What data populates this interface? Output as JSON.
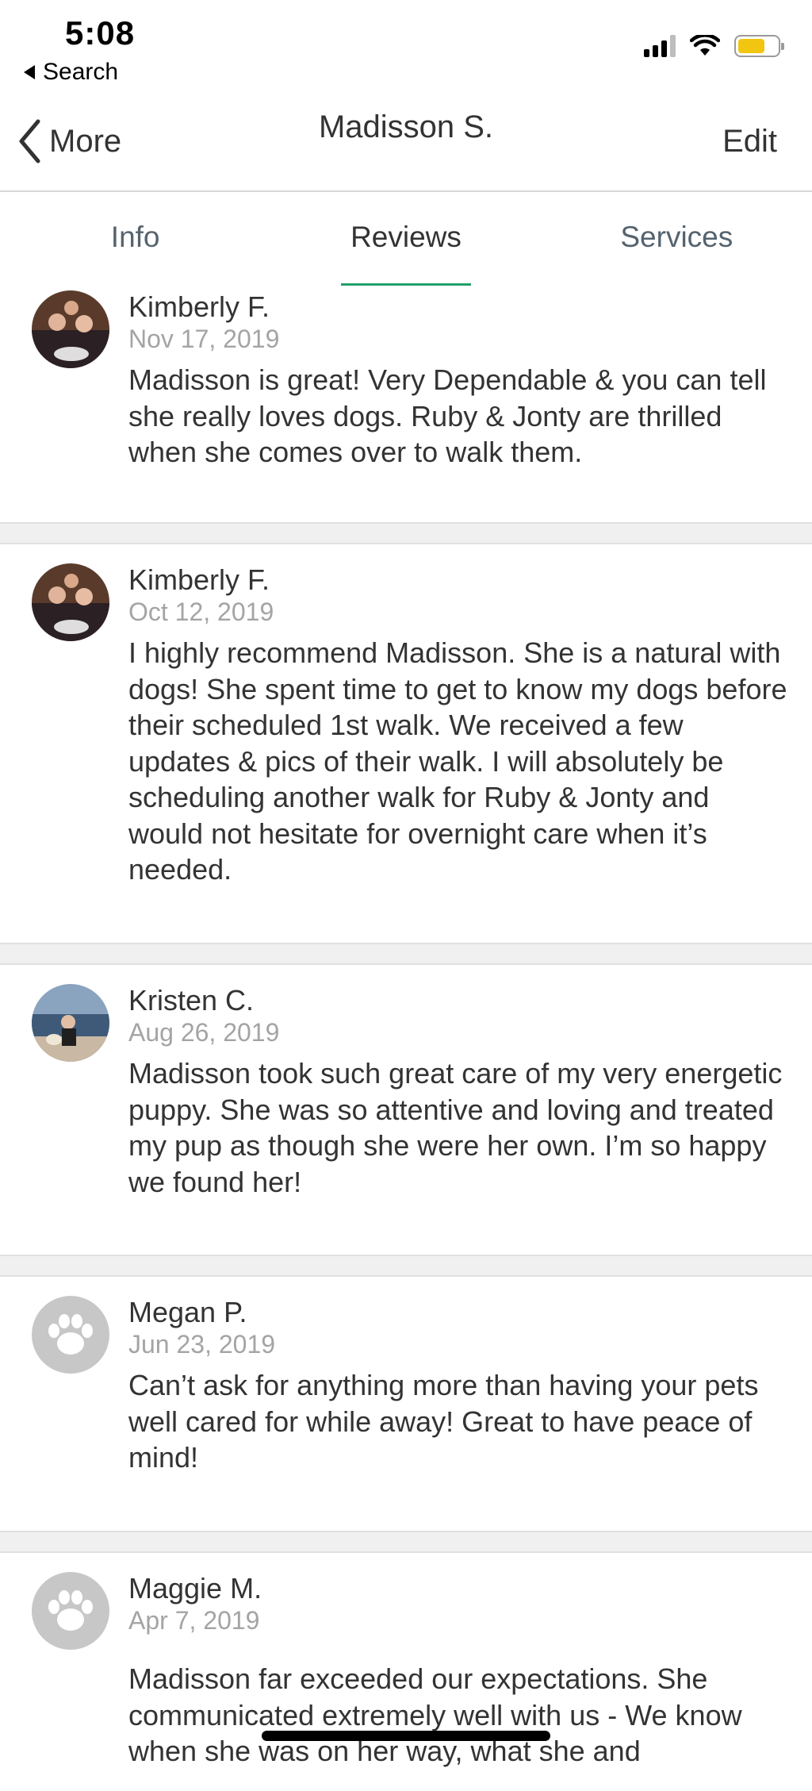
{
  "status_bar": {
    "time": "5:08",
    "back_app": "Search"
  },
  "nav": {
    "back_label": "More",
    "title": "Madisson S.",
    "edit_label": "Edit"
  },
  "tabs": [
    {
      "label": "Info"
    },
    {
      "label": "Reviews"
    },
    {
      "label": "Services"
    }
  ],
  "reviews": [
    {
      "name": "Kimberly F.",
      "date": "Nov 17, 2019",
      "text": "Madisson is great! Very Dependable & you can tell she really loves dogs. Ruby & Jonty are thrilled when she comes over to walk them.",
      "avatar": "photo"
    },
    {
      "name": "Kimberly F.",
      "date": "Oct 12, 2019",
      "text": "I highly recommend Madisson. She is a natural with dogs!  She spent time to get to know my dogs before their scheduled 1st walk.  We received a few updates & pics of their walk.  I will absolutely be scheduling another walk for Ruby & Jonty and would not hesitate for overnight care when it’s needed.",
      "avatar": "photo"
    },
    {
      "name": "Kristen C.",
      "date": "Aug 26, 2019",
      "text": "Madisson took such great care of my very energetic puppy. She was so attentive and loving and treated my pup as though she were her own. I’m so happy we found her!",
      "avatar": "photo"
    },
    {
      "name": "Megan P.",
      "date": "Jun 23, 2019",
      "text": "Can’t ask for anything more than having your pets well cared for while away! Great to have peace of mind!",
      "avatar": "paw"
    },
    {
      "name": "Maggie M.",
      "date": "Apr 7, 2019",
      "text": "Madisson far exceeded our expectations. She communicated extremely well with us -  We know when she was on her way, what she and",
      "avatar": "paw"
    }
  ],
  "colors": {
    "accent": "#22a06b",
    "battery": "#f2c511",
    "muted_text": "#a4a4a4",
    "placeholder_avatar": "#c7c7c7"
  }
}
